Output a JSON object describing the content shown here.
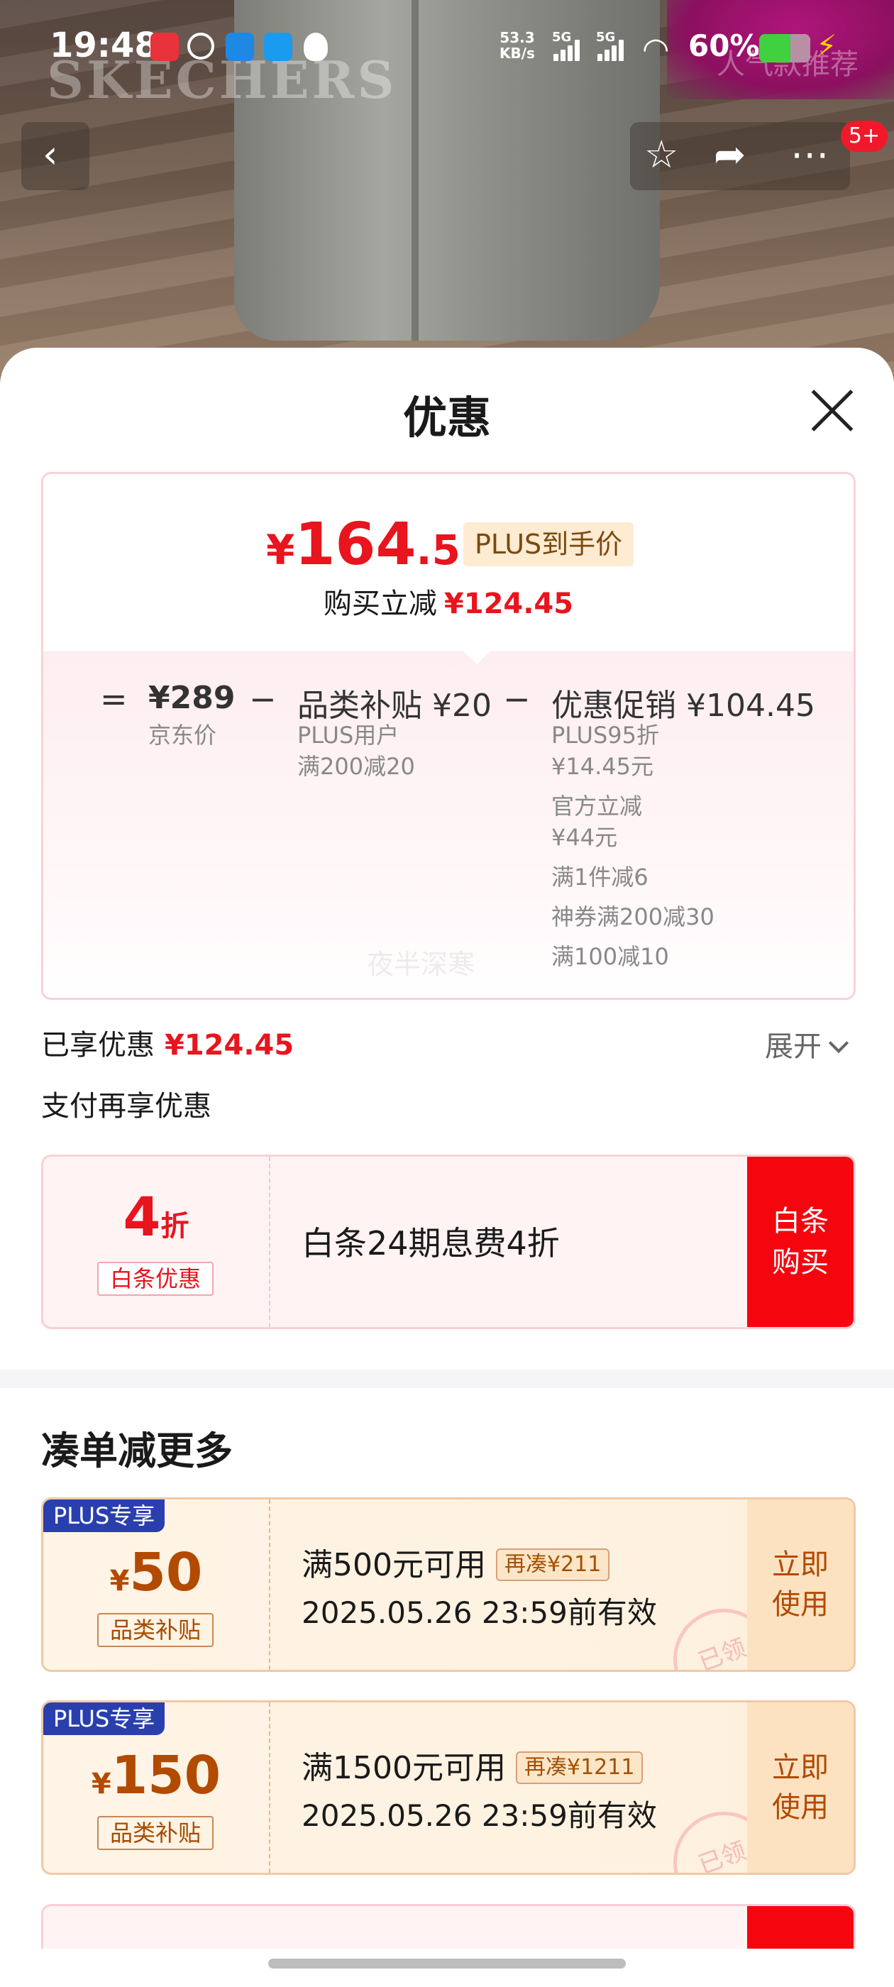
{
  "status_bar": {
    "time": "19:48",
    "net_speed_value": "53.3",
    "net_speed_unit": "KB/s",
    "signal1_label": "5G",
    "signal2_label": "5G",
    "battery": "60%"
  },
  "hero": {
    "brand_logo": "SKECHERS",
    "faded_text": "人气款推荐"
  },
  "nav": {
    "back_icon": "‹",
    "cart_badge": "5+"
  },
  "sheet": {
    "title": "优惠",
    "price_card": {
      "currency": "¥",
      "price_int": "164",
      "price_dec": ".55",
      "price_tag": "PLUS到手价",
      "save_label": "购买立减",
      "save_amount": "¥124.45",
      "equals": "=",
      "minus": "−",
      "jd_price": "¥289",
      "jd_price_label": "京东价",
      "subsidy_title": "品类补贴 ¥20",
      "subsidy_lines": [
        "PLUS用户",
        "满200减20"
      ],
      "promo_title": "优惠促销 ¥104.45",
      "promo_lines": [
        "PLUS95折",
        "¥14.45元",
        "官方立减",
        "¥44元",
        "满1件减6",
        "神券满200减30",
        "满100减10"
      ],
      "watermark": "夜半深寒"
    },
    "enjoyed_label": "已享优惠",
    "enjoyed_amount": "¥124.45",
    "expand_label": "展开",
    "pay_more_label": "支付再享优惠",
    "baitiao": {
      "discount_num": "4",
      "discount_unit": "折",
      "tag": "白条优惠",
      "desc": "白条24期息费4折",
      "button_line1": "白条",
      "button_line2": "购买"
    },
    "more_title": "凑单减更多",
    "coupons": [
      {
        "plus_label": "PLUS专享",
        "currency": "¥",
        "amount": "50",
        "tag": "品类补贴",
        "condition": "满500元可用",
        "extra": "再凑¥211",
        "validity": "2025.05.26 23:59前有效",
        "use_line1": "立即",
        "use_line2": "使用",
        "stamp": "已领"
      },
      {
        "plus_label": "PLUS专享",
        "currency": "¥",
        "amount": "150",
        "tag": "品类补贴",
        "condition": "满1500元可用",
        "extra": "再凑¥1211",
        "validity": "2025.05.26 23:59前有效",
        "use_line1": "立即",
        "use_line2": "使用",
        "stamp": "已领"
      }
    ]
  },
  "colors": {
    "accent_red": "#e8141e",
    "button_red": "#f5060f",
    "plus_blue": "#2a3fae",
    "coupon_brown": "#b24a00"
  },
  "icons": [
    "back-icon",
    "star-icon",
    "share-icon",
    "more-icon",
    "close-icon",
    "chevron-down-icon",
    "wifi-icon",
    "battery-icon"
  ]
}
